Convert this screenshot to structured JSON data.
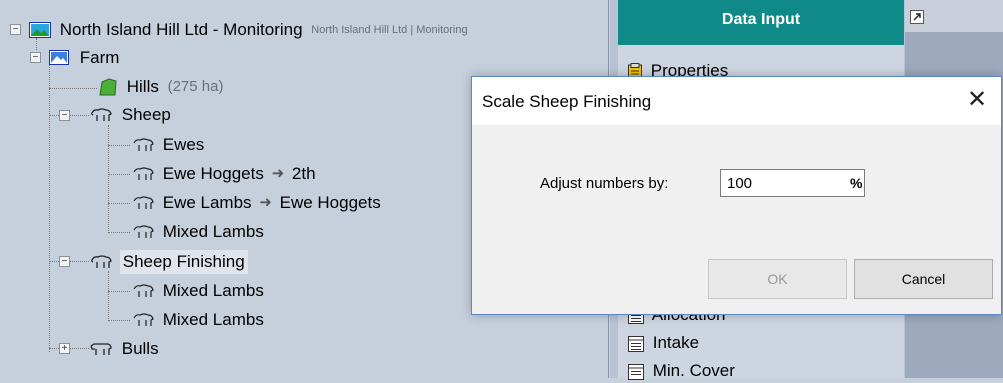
{
  "tree": {
    "root": {
      "label": "North Island Hill Ltd - Monitoring",
      "sublabel": "North Island Hill Ltd | Monitoring"
    },
    "farm": {
      "label": "Farm"
    },
    "hills": {
      "label": "Hills",
      "area": "(275 ha)"
    },
    "sheep": {
      "label": "Sheep"
    },
    "ewes": {
      "label": "Ewes"
    },
    "ewe_hoggets": {
      "label": "Ewe Hoggets",
      "arrow": "➜",
      "target": "2th"
    },
    "ewe_lambs": {
      "label": "Ewe Lambs",
      "arrow": "➜",
      "target": "Ewe Hoggets"
    },
    "mixed_lambs_1": {
      "label": "Mixed Lambs"
    },
    "sheep_finishing": {
      "label": "Sheep Finishing"
    },
    "mixed_lambs_2": {
      "label": "Mixed Lambs"
    },
    "mixed_lambs_3": {
      "label": "Mixed Lambs"
    },
    "bulls": {
      "label": "Bulls"
    },
    "expand_collapsed": "+",
    "expand_open": "−"
  },
  "data_input": {
    "title": "Data Input",
    "items": [
      {
        "label": "Properties",
        "icon": "clipboard-icon"
      },
      {
        "label": "Allocation",
        "icon": "table-icon"
      },
      {
        "label": "Intake",
        "icon": "table-icon"
      },
      {
        "label": "Min. Cover",
        "icon": "table-icon"
      }
    ]
  },
  "dialog": {
    "title": "Scale Sheep Finishing",
    "close_glyph": "✕",
    "adjust_label": "Adjust numbers by:",
    "adjust_value": "100",
    "unit": "%",
    "ok_label": "OK",
    "cancel_label": "Cancel"
  },
  "colors": {
    "header_teal": "#0f8a88",
    "tree_bg": "#c6cfdc",
    "dialog_border": "#5b88c6"
  }
}
